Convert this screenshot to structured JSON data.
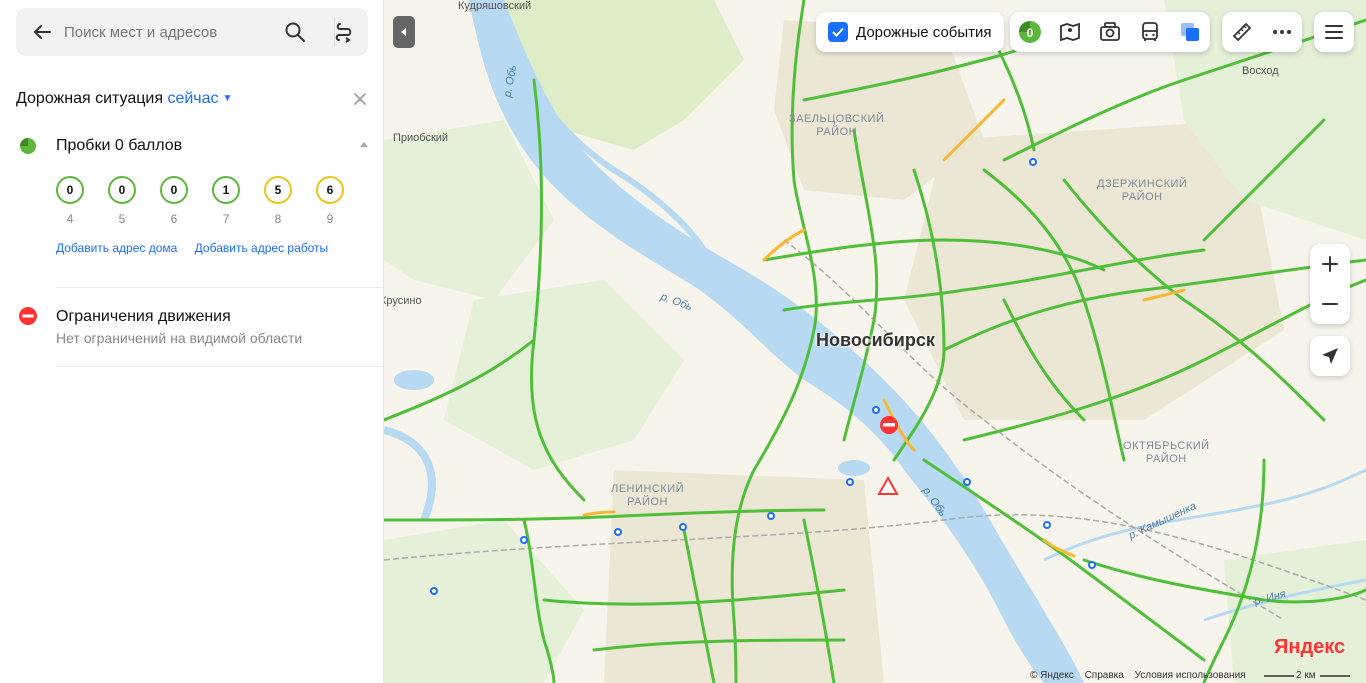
{
  "search": {
    "placeholder": "Поиск мест и адресов"
  },
  "panel": {
    "title": "Дорожная ситуация",
    "when": "сейчас",
    "jams": {
      "title": "Пробки 0 баллов",
      "forecast": [
        {
          "level": "0",
          "hour": "4",
          "color": "#5cb83c"
        },
        {
          "level": "0",
          "hour": "5",
          "color": "#5cb83c"
        },
        {
          "level": "0",
          "hour": "6",
          "color": "#5cb83c"
        },
        {
          "level": "1",
          "hour": "7",
          "color": "#5cb83c"
        },
        {
          "level": "5",
          "hour": "8",
          "color": "#f2c21b"
        },
        {
          "level": "6",
          "hour": "9",
          "color": "#f2c21b"
        }
      ],
      "add_home": "Добавить адрес дома",
      "add_work": "Добавить адрес работы"
    },
    "restrictions": {
      "title": "Ограничения движения",
      "subtitle": "Нет ограничений на видимой области"
    }
  },
  "map": {
    "road_events_label": "Дорожные события",
    "jam_level_badge": "0",
    "labels": {
      "top_left": "Кудряшовский",
      "priobsky": "Приобский",
      "krusino": "Крусино",
      "voskhod": "Восход",
      "city": "Новосибирск",
      "zaeltsovsky": "ЗАЕЛЬЦОВСКИЙ\nРАЙОН",
      "dzerzhinsky": "ДЗЕРЖИНСКИЙ\nРАЙОН",
      "leninsky": "ЛЕНИНСКИЙ\nРАЙОН",
      "oktyabrsky": "ОКТЯБРЬСКИЙ\nРАЙОН",
      "river_ob_1": "р. Обь",
      "river_ob_2": "р. Обь",
      "river_ob_3": "р. Обь",
      "river_kamyshenka": "р. Камышенка",
      "river_inya": "р. Иня"
    },
    "logo": "Яндекс",
    "footer": {
      "copyright": "© Яндекс",
      "help": "Справка",
      "terms": "Условия использования",
      "scale": "2 км"
    }
  }
}
